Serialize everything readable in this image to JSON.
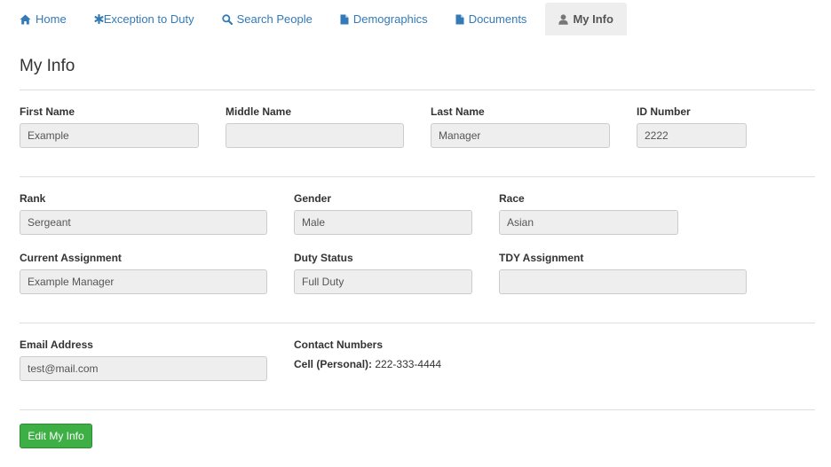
{
  "nav": {
    "tabs": [
      {
        "label": "Home",
        "icon": "home-icon"
      },
      {
        "label": "Exception to Duty",
        "icon": "asterisk-icon"
      },
      {
        "label": "Search People",
        "icon": "search-icon"
      },
      {
        "label": "Demographics",
        "icon": "document-icon"
      },
      {
        "label": "Documents",
        "icon": "document-icon"
      },
      {
        "label": "My Info",
        "icon": "user-icon",
        "active": true
      }
    ]
  },
  "page": {
    "title": "My Info"
  },
  "form": {
    "first_name": {
      "label": "First Name",
      "value": "Example"
    },
    "middle_name": {
      "label": "Middle Name",
      "value": ""
    },
    "last_name": {
      "label": "Last Name",
      "value": "Manager"
    },
    "id_number": {
      "label": "ID Number",
      "value": "2222"
    },
    "rank": {
      "label": "Rank",
      "value": "Sergeant"
    },
    "gender": {
      "label": "Gender",
      "value": "Male"
    },
    "race": {
      "label": "Race",
      "value": "Asian"
    },
    "current_assignment": {
      "label": "Current Assignment",
      "value": "Example Manager"
    },
    "duty_status": {
      "label": "Duty Status",
      "value": "Full Duty"
    },
    "tdy_assignment": {
      "label": "TDY Assignment",
      "value": ""
    },
    "email": {
      "label": "Email Address",
      "value": "test@mail.com"
    }
  },
  "contact": {
    "label": "Contact Numbers",
    "cell_label": "Cell (Personal):",
    "cell_value": "222-333-4444"
  },
  "actions": {
    "edit_label": "Edit My Info"
  },
  "colors": {
    "link": "#337ab7",
    "active_tab_bg": "#eeeeee",
    "button_green": "#3daf45",
    "readonly_input_bg": "#eeeeee"
  }
}
